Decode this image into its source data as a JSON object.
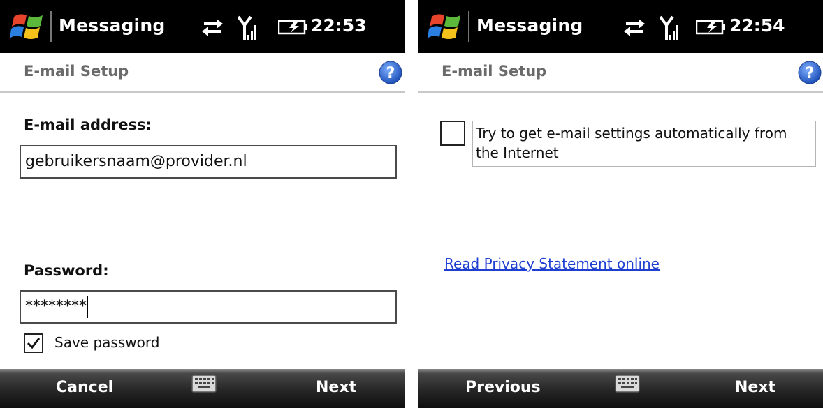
{
  "status_bar": {
    "app_title": "Messaging"
  },
  "screens": [
    {
      "clock": "22:53",
      "title": "E-mail Setup",
      "email_label": "E-mail address:",
      "email_value": "gebruikersnaam@provider.nl",
      "password_label": "Password:",
      "password_value": "********",
      "save_password_label": "Save password",
      "save_password_checked": true,
      "softkeys": {
        "left": "Cancel",
        "right": "Next"
      }
    },
    {
      "clock": "22:54",
      "title": "E-mail Setup",
      "auto_settings_label": "Try to get e-mail settings automatically from the Internet",
      "auto_settings_checked": false,
      "privacy_link": "Read Privacy Statement online",
      "softkeys": {
        "left": "Previous",
        "right": "Next"
      }
    }
  ],
  "icons": {
    "windows_logo": "windows-flag",
    "sync": "sync-arrows",
    "signal": "signal-antenna",
    "battery": "battery-charging",
    "help": "help-question",
    "keyboard": "keyboard"
  },
  "colors": {
    "status_bar_bg": "#000000",
    "title_text": "#6a6a6a",
    "link": "#1f3fd0",
    "help_blue": "#2f62c9"
  }
}
